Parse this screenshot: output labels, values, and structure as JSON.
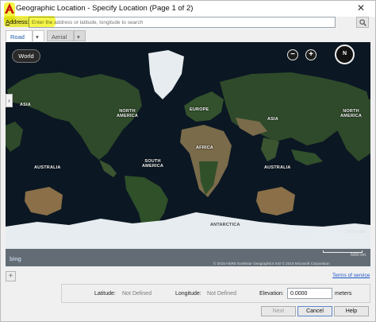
{
  "window": {
    "title": "Geographic Location - Specify Location (Page 1 of 2)",
    "close_symbol": "✕",
    "logo_icon": "autocad-logo-icon"
  },
  "address": {
    "label_prefix": "A",
    "label_rest": "ddress:",
    "placeholder": "Enter the address or latitude, longitude to search",
    "search_icon": "search-icon"
  },
  "view_tabs": {
    "road": "Road",
    "aerial": "Aerial",
    "arrow": "▾"
  },
  "map": {
    "world_button": "World",
    "zoom_out": "−",
    "zoom_in": "+",
    "compass": "N",
    "side_toggle": "›",
    "labels": {
      "asia_left": "ASIA",
      "north_america": "NORTH\nAMERICA",
      "europe": "EUROPE",
      "asia_center": "ASIA",
      "north_america_right": "NORTH\nAMERICA",
      "africa": "AFRICA",
      "australia_left": "AUSTRALIA",
      "south_america": "SOUTH\nAMERICA",
      "australia_right": "AUSTRALIA",
      "antarctica": "ANTARCTICA"
    },
    "scale_miles": "2500 miles",
    "scale_km": "5000 km",
    "bing": "bing",
    "copyright": "© 2015 HERE   Earthstar Geographics SIO   © 2015 Microsoft Corporation"
  },
  "footer": {
    "terms": "Terms of service",
    "latitude_label": "Latitude:",
    "latitude_value": "Not Defined",
    "longitude_label": "Longitude:",
    "longitude_value": "Not Defined",
    "elevation_label": "Elevation:",
    "elevation_value": "0.0000",
    "elevation_unit": "meters",
    "add_symbol": "+",
    "next": "Next",
    "cancel": "Cancel",
    "help": "Help"
  },
  "colors": {
    "ocean": "#0b1723",
    "land": "#2f4a2a",
    "desert": "#7a6b4a",
    "ice": "#e6ecef",
    "highlight": "#f5f528",
    "link": "#1b55c8"
  }
}
